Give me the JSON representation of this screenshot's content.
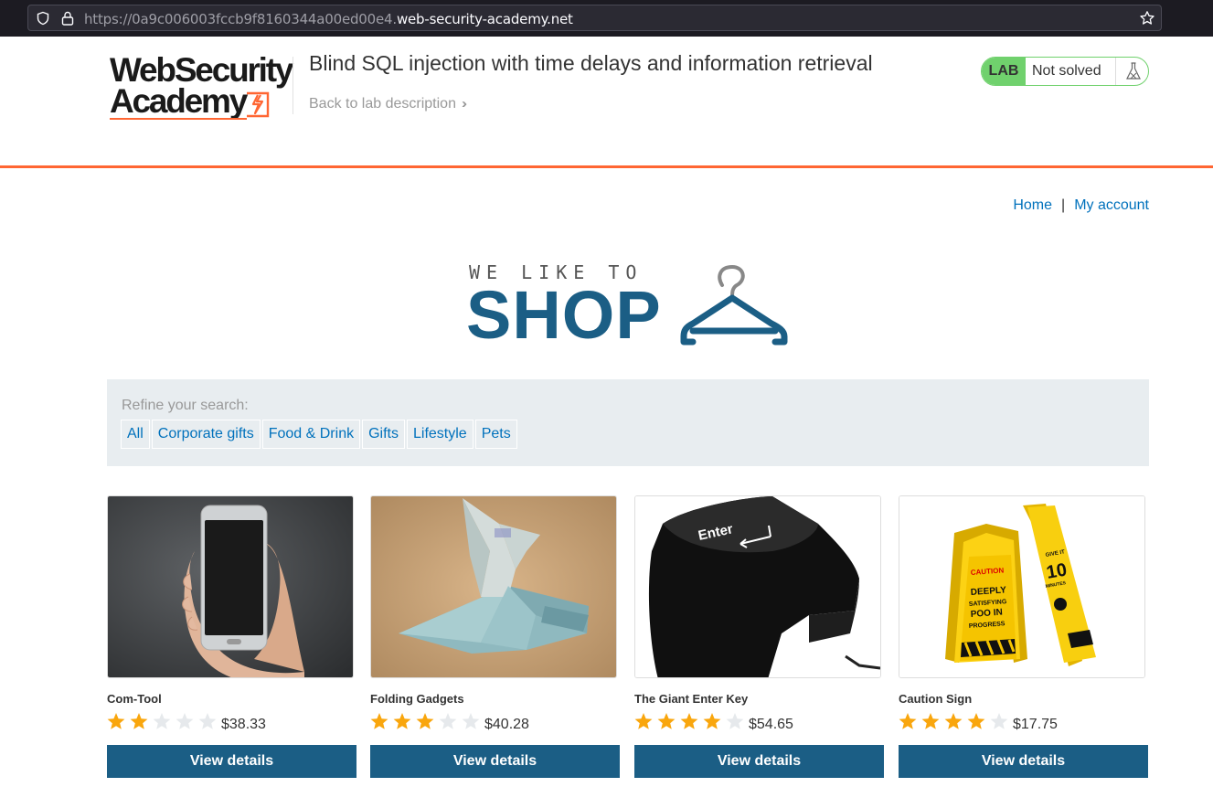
{
  "browser": {
    "url_prefix": "https://0a9c006003fccb9f8160344a00ed00e4.",
    "url_domain": "web-security-academy.net"
  },
  "academy": {
    "logo_line1": "WebSecurity",
    "logo_line2": "Academy",
    "lab_title": "Blind SQL injection with time delays and information retrieval",
    "back_link": "Back to lab description",
    "lab_badge": "LAB",
    "lab_state": "Not solved",
    "accent_color": "#ff6633",
    "status_color": "#70d16d"
  },
  "nav": {
    "home": "Home",
    "separator": "|",
    "my_account": "My account"
  },
  "shop_logo": {
    "tagline": "WE LIKE TO",
    "word": "SHOP"
  },
  "filters": {
    "label": "Refine your search:",
    "items": [
      "All",
      "Corporate gifts",
      "Food & Drink",
      "Gifts",
      "Lifestyle",
      "Pets"
    ]
  },
  "products": [
    {
      "name": "Com-Tool",
      "price": "$38.33",
      "stars": 2,
      "button": "View details",
      "image": "phone-in-hand"
    },
    {
      "name": "Folding Gadgets",
      "price": "$40.28",
      "stars": 3,
      "button": "View details",
      "image": "origami-banknote"
    },
    {
      "name": "The Giant Enter Key",
      "price": "$54.65",
      "stars": 4,
      "button": "View details",
      "image": "giant-enter-key"
    },
    {
      "name": "Caution Sign",
      "price": "$17.75",
      "stars": 4,
      "button": "View details",
      "image": "caution-sign"
    }
  ],
  "image_text": {
    "enter_key": "Enter",
    "caution_1": "CAUTION",
    "caution_2": "DEEPLY",
    "caution_3": "SATISFYING",
    "caution_4": "POO IN",
    "caution_5": "PROGRESS",
    "give_it": "GIVE IT",
    "give_num": "10",
    "give_min": "MINUTES"
  }
}
